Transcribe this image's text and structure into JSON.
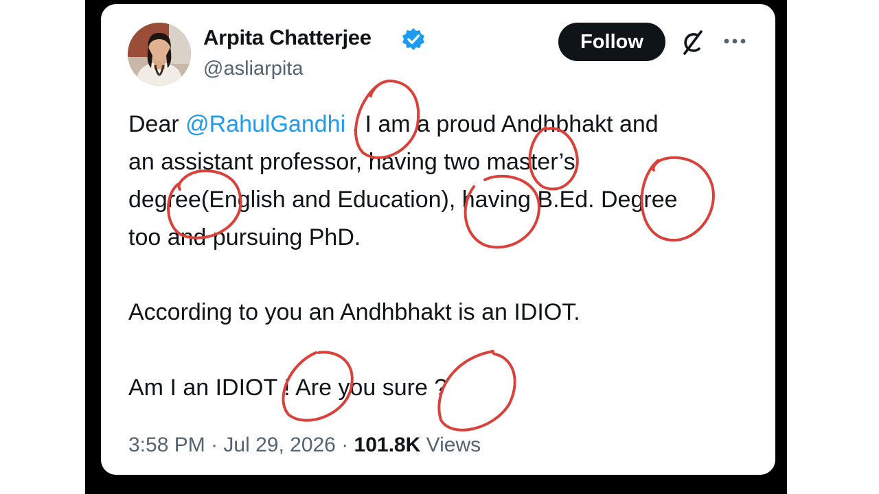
{
  "tweet": {
    "author_name": "Arpita Chatterjee",
    "handle": "@asliarpita",
    "follow_label": "Follow",
    "line1_pre": "Dear ",
    "line1_mention": "@RahulGandhi",
    "line1_post": " , I am a proud Andhbhakt and",
    "line2": "an assistant professor, having two master’s",
    "line3": "degree(English and Education), having B.Ed. Degree",
    "line4": "too and pursuing PhD.",
    "para2": "According to you an Andhbhakt is an IDIOT.",
    "para3": "Am I an IDIOT ! Are you sure ?",
    "time": "3:58 PM",
    "date": "Jul 29, 2026",
    "separator": " · ",
    "views_count": "101.8K",
    "views_label": " Views"
  },
  "icons": {
    "verified": "verified-badge-icon",
    "grok": "grok-icon",
    "more": "more-options-icon"
  },
  "colors": {
    "mention": "#1d9bf0",
    "verified": "#1d9bf0",
    "annotation": "#d9413b",
    "follow_bg": "#0f1419"
  }
}
